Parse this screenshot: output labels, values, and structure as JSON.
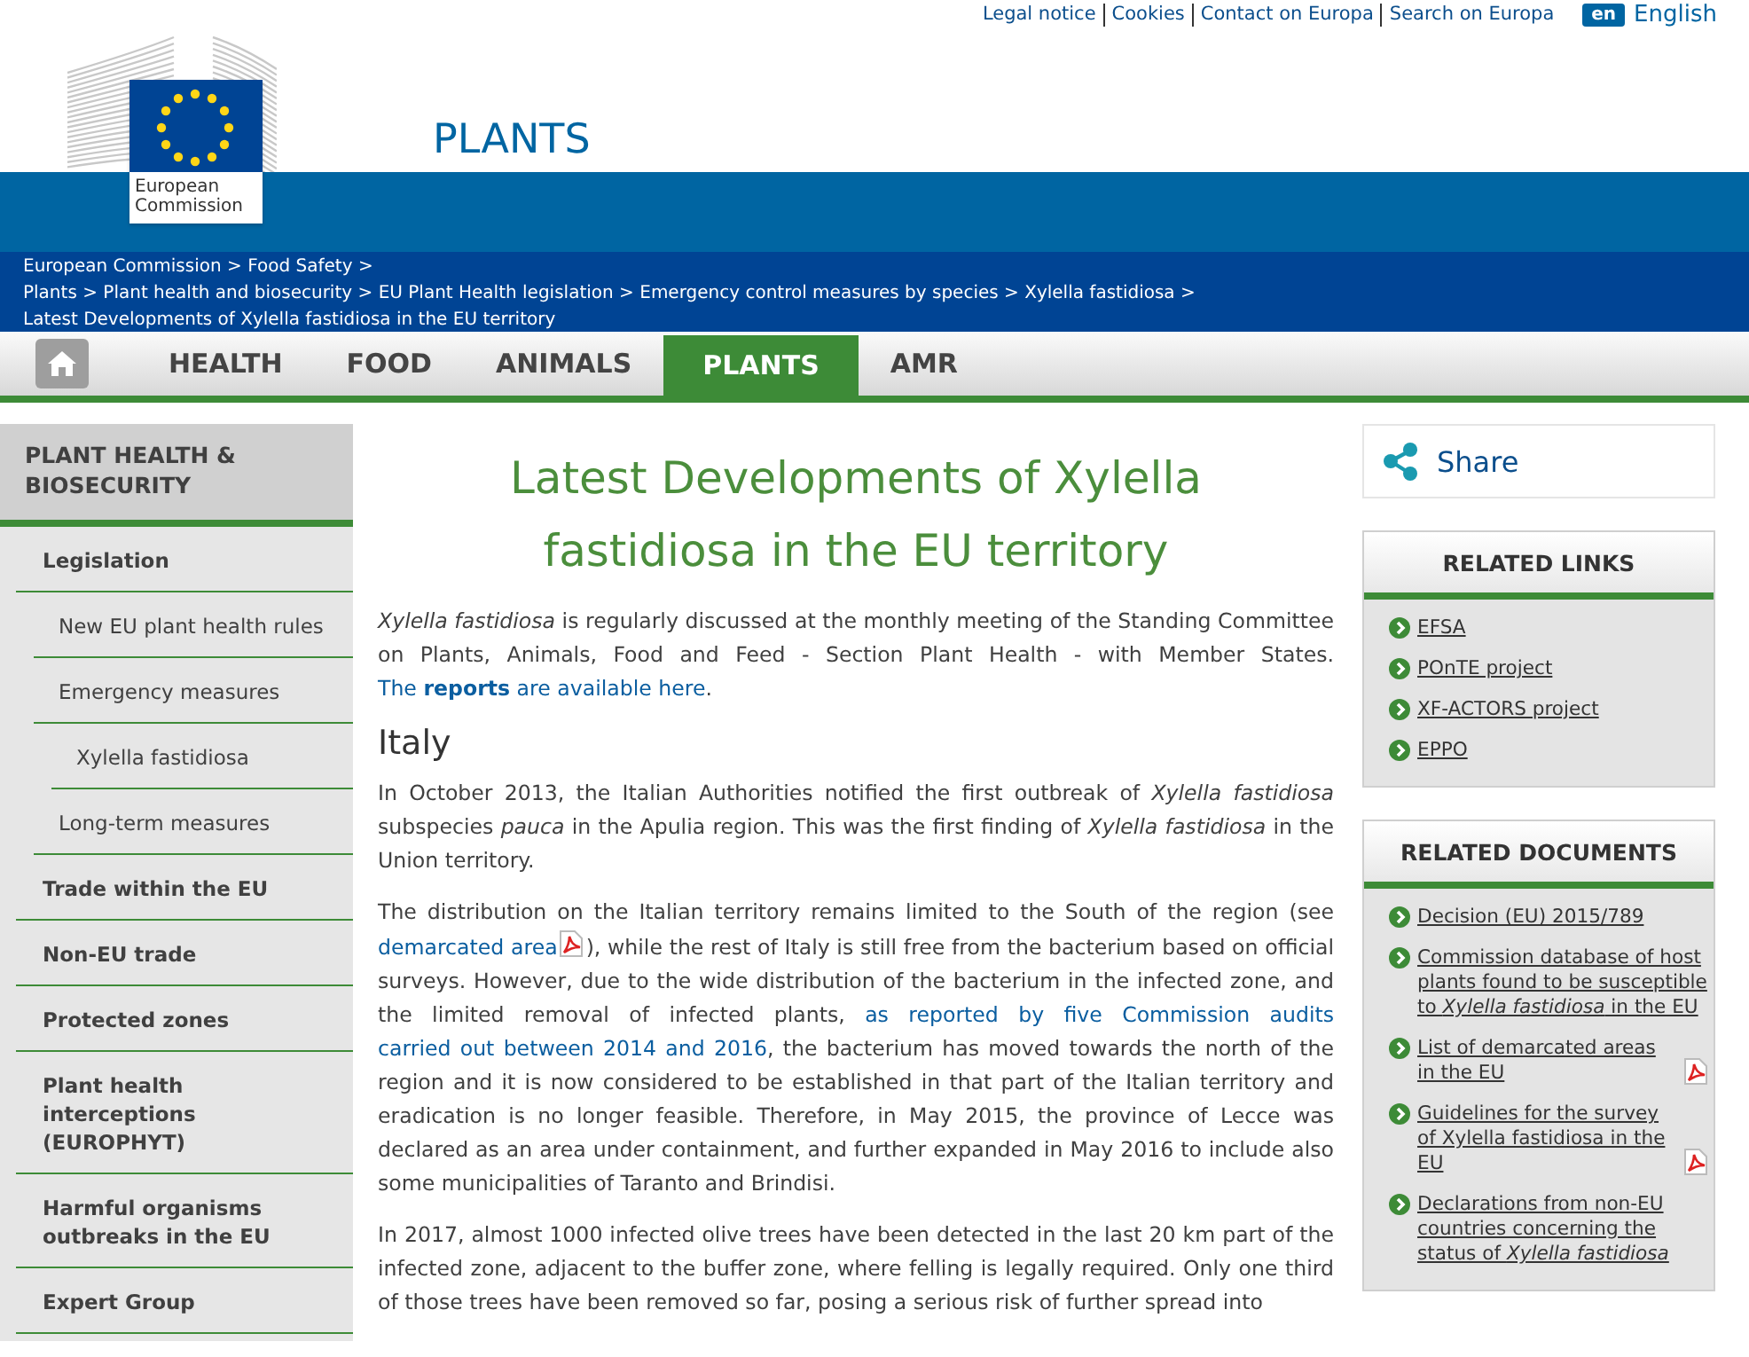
{
  "top_links": [
    "Legal notice",
    "Cookies",
    "Contact on Europa",
    "Search on Europa"
  ],
  "language": {
    "code": "en",
    "name": "English"
  },
  "logo": {
    "text": "European Commission"
  },
  "site_title": "PLANTS",
  "breadcrumb": [
    [
      {
        "label": "European Commission",
        "sep": ">"
      },
      {
        "label": "Food Safety",
        "sep": ">"
      }
    ],
    [
      {
        "label": "Plants",
        "sep": ">"
      },
      {
        "label": "Plant health and biosecurity",
        "sep": ">"
      },
      {
        "label": "EU Plant Health legislation",
        "sep": ">"
      },
      {
        "label": "Emergency control measures by species",
        "sep": ">"
      },
      {
        "label": "Xylella fastidiosa",
        "sep": ">"
      },
      {
        "label": "Latest Developments of Xylella fastidiosa in the EU territory"
      }
    ]
  ],
  "nav": [
    {
      "label": "HEALTH",
      "selected": false
    },
    {
      "label": "FOOD",
      "selected": false
    },
    {
      "label": "ANIMALS",
      "selected": false
    },
    {
      "label": "PLANTS",
      "selected": true
    },
    {
      "label": "AMR",
      "selected": false
    }
  ],
  "sidebar": {
    "title": "PLANT HEALTH & BIOSECURITY",
    "items": [
      {
        "label": "Legislation",
        "children": [
          {
            "label": "New EU plant health rules"
          },
          {
            "label": "Emergency measures",
            "children": [
              {
                "label": "Xylella fastidiosa"
              }
            ]
          },
          {
            "label": "Long-term measures"
          }
        ]
      },
      {
        "label": "Trade within the EU"
      },
      {
        "label": "Non-EU trade"
      },
      {
        "label": "Protected zones"
      },
      {
        "label": "Plant health interceptions (EUROPHYT)"
      },
      {
        "label": "Harmful organisms outbreaks in the EU"
      },
      {
        "label": "Expert Group"
      }
    ]
  },
  "article": {
    "title": "Latest Developments of Xylella fastidiosa in the EU territory",
    "blocks": [
      {
        "kind": "paragraph",
        "parts": [
          {
            "kind": "text",
            "text": "*Xylella fastidiosa* is regularly discussed at the monthly meeting of the Standing Committee on Plants, Animals, Food and Feed - Section Plant Health - with Member States. "
          },
          {
            "kind": "link",
            "text": "The **reports** are available here"
          },
          {
            "kind": "text",
            "text": "."
          }
        ]
      },
      {
        "kind": "heading",
        "text": "Italy"
      },
      {
        "kind": "paragraph",
        "parts": [
          {
            "kind": "text",
            "text": "In October 2013, the Italian Authorities notified the first outbreak of *Xylella fastidiosa* subspecies *pauca* in the Apulia region. This was the first finding of *Xylella fastidiosa* in the Union territory."
          }
        ]
      },
      {
        "kind": "paragraph",
        "parts": [
          {
            "kind": "text",
            "text": "The distribution on the Italian territory remains limited to the South of the region (see "
          },
          {
            "kind": "link",
            "text": "demarcated area",
            "pdf": true
          },
          {
            "kind": "text",
            "text": "), while the rest of Italy is still free from the bacterium based on official surveys. However, due to the wide distribution of the bacterium in the infected zone, and the limited removal of infected plants, "
          },
          {
            "kind": "link",
            "text": "as reported by five Commission audits"
          },
          {
            "kind": "link",
            "text": "carried out between 2014 and 2016"
          },
          {
            "kind": "text",
            "text": ", the bacterium has moved towards the north of the region and it is now considered to be established in that part of the Italian territory and eradication is no longer feasible. Therefore, in May 2015, the province of Lecce was declared as an area under containment, and further expanded in May 2016 to include also some municipalities of Taranto and Brindisi."
          }
        ]
      },
      {
        "kind": "paragraph",
        "parts": [
          {
            "kind": "text",
            "text": "In 2017, almost 1000 infected olive trees have been detected in the last 20 km part of the infected zone, adjacent to the buffer zone, where felling is legally required. Only one third of those trees have been removed so far, posing a serious risk of further spread into"
          }
        ]
      }
    ]
  },
  "share": {
    "label": "Share"
  },
  "related_links": {
    "title": "RELATED LINKS",
    "items": [
      {
        "text": "EFSA"
      },
      {
        "text": "POnTE project"
      },
      {
        "text": "XF-ACTORS project"
      },
      {
        "text": "EPPO"
      }
    ]
  },
  "related_documents": {
    "title": "RELATED DOCUMENTS",
    "items": [
      {
        "text": "Decision (EU) 2015/789"
      },
      {
        "text": "Commission database of host plants found to be susceptible to *Xylella fastidiosa* in the EU"
      },
      {
        "text": "List of demarcated areas in the EU",
        "pdf": true
      },
      {
        "text": "Guidelines for the survey of Xylella fastidiosa in the EU",
        "pdf": true
      },
      {
        "text": "Declarations from non-EU countries concerning the status of *Xylella fastidiosa*"
      }
    ]
  }
}
